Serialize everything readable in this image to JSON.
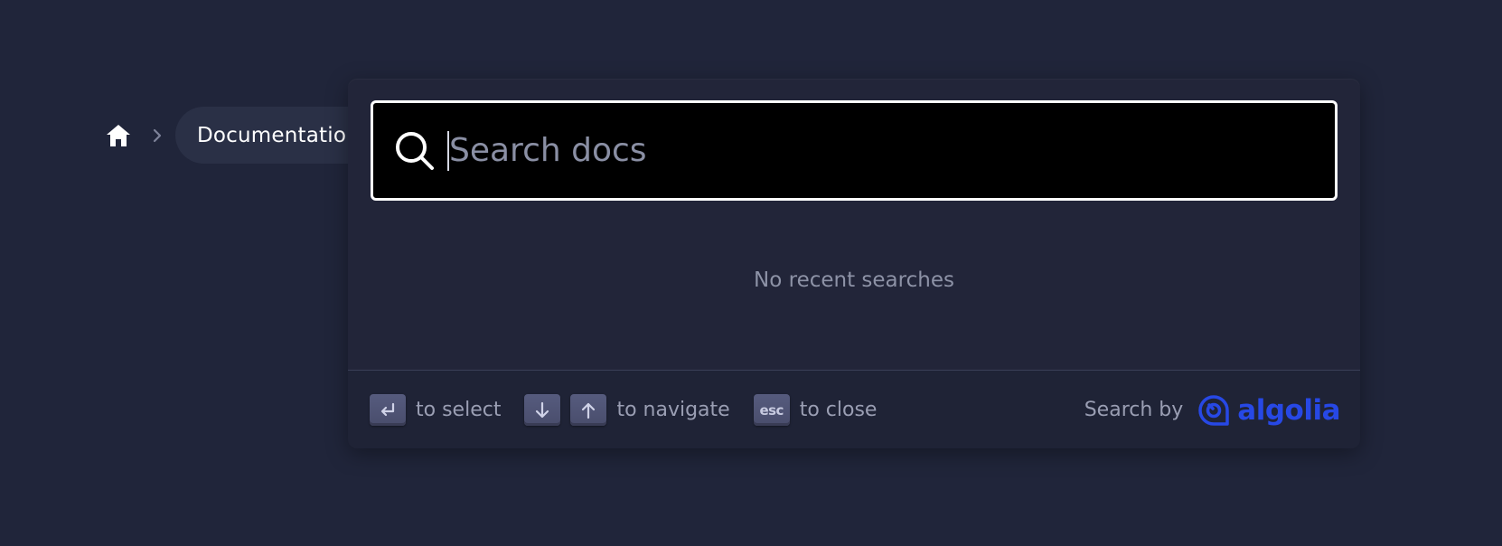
{
  "breadcrumb": {
    "home_icon": "home-icon",
    "separator_icon": "chevron-right-icon",
    "current": "Documentation Hub"
  },
  "search": {
    "placeholder": "Search docs",
    "value": "",
    "icon": "search-icon"
  },
  "results": {
    "empty_message": "No recent searches"
  },
  "footer": {
    "commands": [
      {
        "keys": [
          "enter"
        ],
        "label": "to select"
      },
      {
        "keys": [
          "arrow-down",
          "arrow-up"
        ],
        "label": "to navigate"
      },
      {
        "keys": [
          "esc"
        ],
        "esc_text": "esc",
        "label": "to close"
      }
    ],
    "search_by_label": "Search by",
    "logo_text": "algolia"
  },
  "colors": {
    "background": "#20253a",
    "modal": "#222539",
    "search_bg": "#000000",
    "accent": "#2748e5",
    "muted_text": "#8d92a6"
  }
}
